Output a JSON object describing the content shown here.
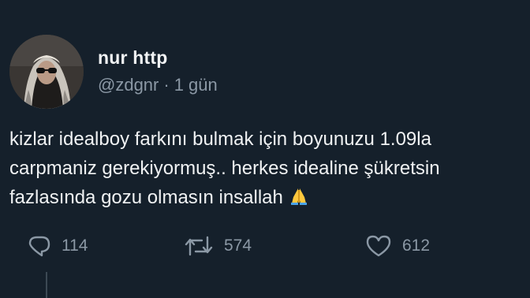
{
  "tweet": {
    "author": {
      "display_name": "nur http",
      "handle": "@zdgnr",
      "separator": "·",
      "time": "1 gün"
    },
    "text_lines": [
      "kizlar idealboy farkını bulmak için boyunuzu 1.09la",
      "carpmaniz gerekiyormuş.. herkes idealine şükretsin",
      "fazlasında gozu olmasın insallah"
    ],
    "emoji": "🙏",
    "actions": {
      "replies": "114",
      "retweets": "574",
      "likes": "612"
    }
  },
  "colors": {
    "background": "#15202b",
    "text": "#e7e9ea",
    "muted": "#8b98a5"
  },
  "icons": [
    "reply-icon",
    "retweet-icon",
    "like-icon",
    "folded-hands-emoji"
  ]
}
